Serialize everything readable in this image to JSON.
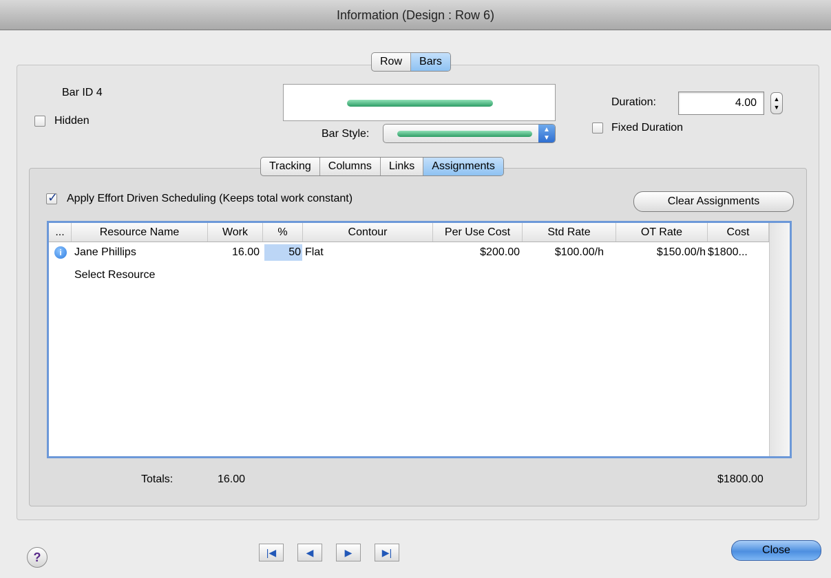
{
  "window": {
    "title": "Information (Design : Row 6)"
  },
  "top_tabs": [
    {
      "label": "Row",
      "selected": false
    },
    {
      "label": "Bars",
      "selected": true
    }
  ],
  "bar": {
    "id_label": "Bar ID 4",
    "hidden_label": "Hidden",
    "hidden_checked": false,
    "style_label": "Bar Style:",
    "bar_color": "#3aa874"
  },
  "duration": {
    "label": "Duration:",
    "value": "4.00",
    "fixed_label": "Fixed Duration",
    "fixed_checked": false
  },
  "sub_tabs": [
    {
      "label": "Tracking",
      "selected": false
    },
    {
      "label": "Columns",
      "selected": false
    },
    {
      "label": "Links",
      "selected": false
    },
    {
      "label": "Assignments",
      "selected": true
    }
  ],
  "assignments": {
    "effort_label": "Apply Effort Driven Scheduling (Keeps total work constant)",
    "effort_checked": true,
    "clear_label": "Clear Assignments",
    "columns": [
      "...",
      "Resource Name",
      "Work",
      "%",
      "Contour",
      "Per Use Cost",
      "Std Rate",
      "OT Rate",
      "Cost"
    ],
    "rows": [
      {
        "name": "Jane Phillips",
        "work": "16.00",
        "percent": "50",
        "contour": "Flat",
        "per_use_cost": "$200.00",
        "std_rate": "$100.00/h",
        "ot_rate": "$150.00/h",
        "cost": "$1800..."
      }
    ],
    "placeholder_row": "Select Resource",
    "totals_label": "Totals:",
    "totals_work": "16.00",
    "totals_cost": "$1800.00"
  },
  "footer": {
    "close_label": "Close",
    "help_label": "?"
  },
  "colors": {
    "accent": "#6c98d8",
    "selected_tab": "#8ec2f2",
    "info_icon": "#2f7de0"
  }
}
